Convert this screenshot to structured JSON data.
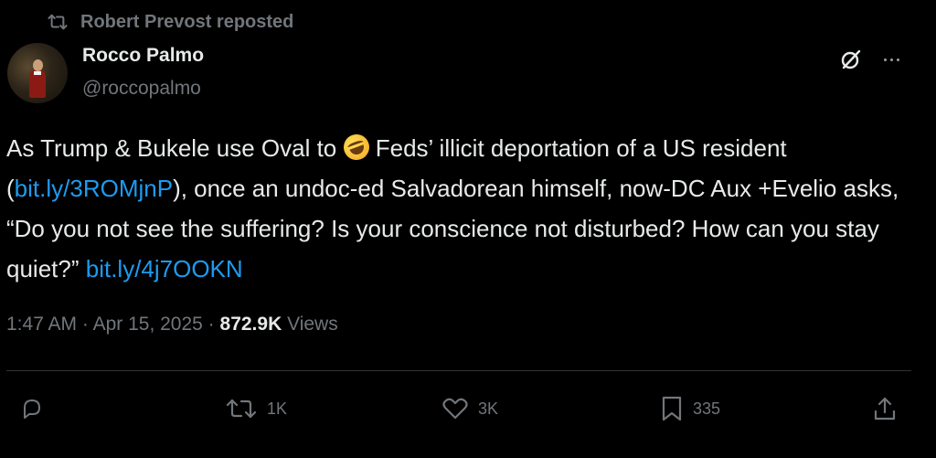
{
  "repost": {
    "label": "Robert Prevost reposted"
  },
  "author": {
    "display_name": "Rocco Palmo",
    "handle": "@roccopalmo"
  },
  "tweet": {
    "line1_a": "As Trump & Bukele use Oval to ",
    "emoji": "rolling-on-floor-laughing-emoji",
    "line1_b": " Feds’ illicit deportation of a US resident (",
    "link1": "bit.ly/3ROMjnP",
    "line2": "), once an undoc-ed Salvadorean himself, now-DC Aux +Evelio asks, “Do you not see the suffering? Is your conscience not disturbed? How can you stay quiet?” ",
    "link2": "bit.ly/4j7OOKN"
  },
  "meta": {
    "time": "1:47 AM",
    "sep1": " · ",
    "date": "Apr 15, 2025",
    "sep2": " · ",
    "views_count": "872.9K",
    "views_label": " Views"
  },
  "actions": {
    "reply": {
      "icon": "reply-icon",
      "count": ""
    },
    "repost": {
      "icon": "repost-icon",
      "count": "1K"
    },
    "like": {
      "icon": "heart-icon",
      "count": "3K"
    },
    "bookmark": {
      "icon": "bookmark-icon",
      "count": "335"
    },
    "share": {
      "icon": "share-icon",
      "count": ""
    }
  },
  "colors": {
    "background": "#000000",
    "text": "#e7e9ea",
    "muted": "#71767b",
    "link": "#1d9bf0",
    "divider": "#2f3336"
  }
}
